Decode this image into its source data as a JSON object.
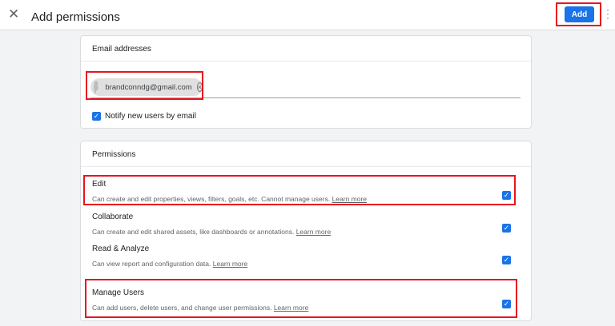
{
  "header": {
    "title": "Add permissions",
    "add_label": "Add",
    "close_icon": "close-icon",
    "more_icon": "more-vert-icon"
  },
  "email": {
    "heading": "Email addresses",
    "chip": "brandconndg@gmail.com",
    "notify_label": "Notify new users by email",
    "notify_checked": true
  },
  "permissions": {
    "heading": "Permissions",
    "items": [
      {
        "name": "Edit",
        "desc": "Can create and edit properties, views, filters, goals, etc. Cannot manage users.",
        "link": "Learn more",
        "checked": true
      },
      {
        "name": "Collaborate",
        "desc": "Can create and edit shared assets, like dashboards or annotations.",
        "link": "Learn more",
        "checked": true
      },
      {
        "name": "Read & Analyze",
        "desc": "Can view report and configuration data.",
        "link": "Learn more",
        "checked": true
      },
      {
        "name": "Manage Users",
        "desc": "Can add users, delete users, and change user permissions.",
        "link": "Learn more",
        "checked": true
      }
    ]
  },
  "colors": {
    "accent": "#1a73e8",
    "annotation": "#e8141e"
  }
}
